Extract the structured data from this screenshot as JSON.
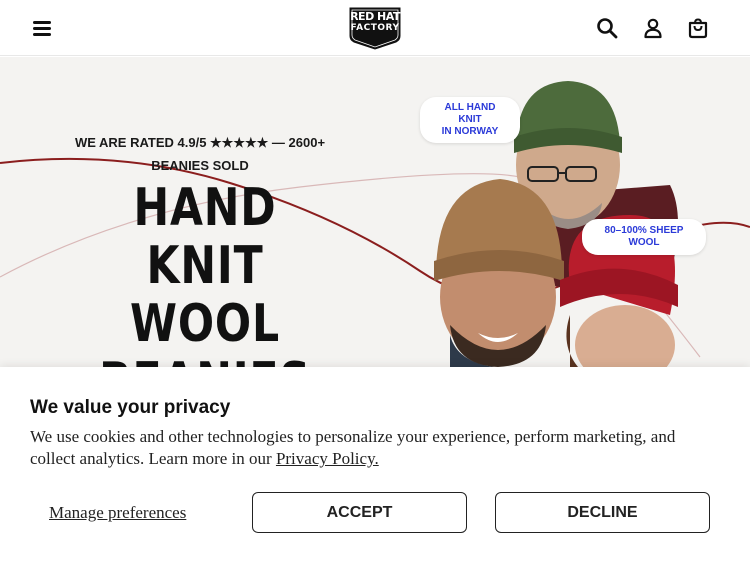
{
  "header": {
    "menu_icon": "hamburger-menu-icon",
    "logo": {
      "line1": "RED HAT",
      "line2": "FACTORY",
      "icon": "shield-badge-logo"
    },
    "icons": [
      "search-icon",
      "user-icon",
      "cart-bag-icon"
    ]
  },
  "hero": {
    "rating_line1": "WE ARE RATED 4.9/5 ★★★★★ — 2600+",
    "rating_line2": "BEANIES SOLD",
    "headline": [
      "HAND KNIT",
      "WOOL",
      "BEANIES"
    ],
    "badge_norway": [
      "ALL HAND KNIT",
      "IN NORWAY"
    ],
    "badge_wool": "80–100% SHEEP WOOL",
    "colors": {
      "background": "#f4f3f1",
      "curve": "#8b1e1e",
      "badge_text": "#2b3ad8"
    }
  },
  "cookie_banner": {
    "title": "We value your privacy",
    "body": "We use cookies and other technologies to personalize your experience, perform marketing, and collect analytics. Learn more in our ",
    "link": "Privacy Policy.",
    "manage_label": "Manage preferences",
    "accept_label": "ACCEPT",
    "decline_label": "DECLINE"
  }
}
